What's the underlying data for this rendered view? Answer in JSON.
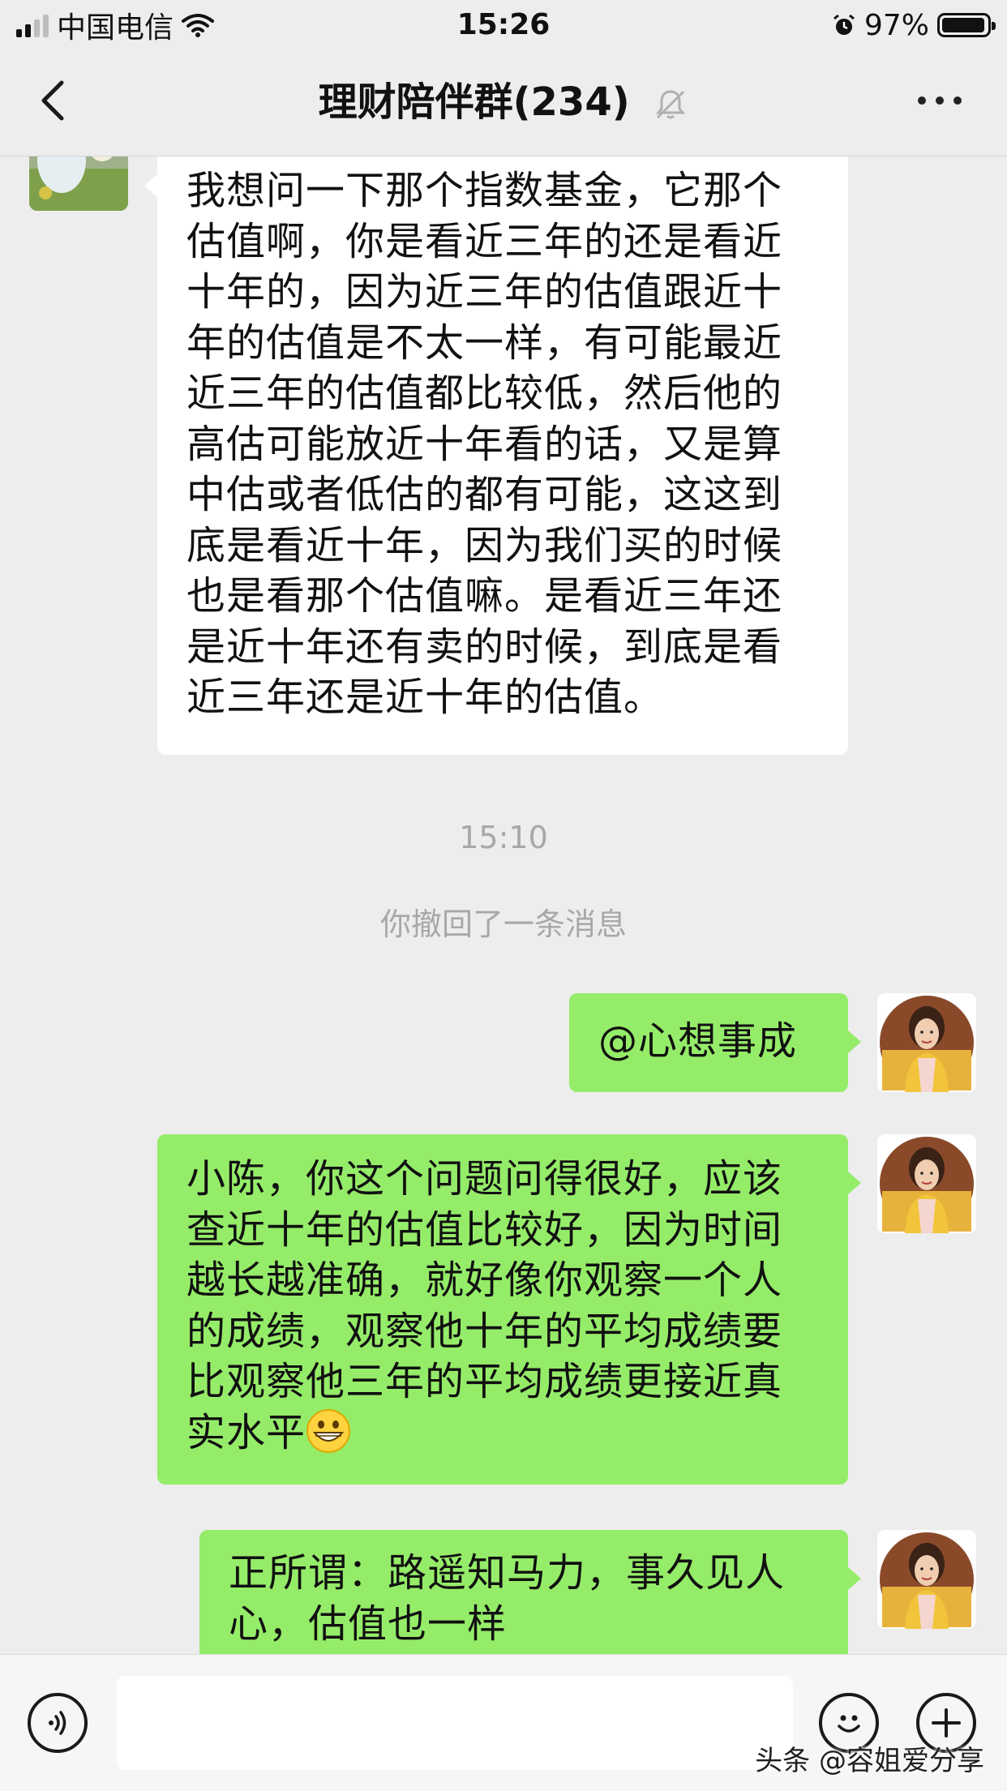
{
  "status_bar": {
    "carrier": "中国电信",
    "time": "15:26",
    "battery_percent_text": "97%",
    "battery_level": 0.97,
    "signal_bars_filled": 2,
    "signal_bars_total": 4
  },
  "navbar": {
    "title": "理财陪伴群(234)",
    "back_icon": "chevron-left-icon",
    "mute_icon": "bell-off-icon",
    "more_icon": "more-dots-icon"
  },
  "messages": {
    "incoming_1": "我想问一下那个指数基金，它那个估值啊，你是看近三年的还是看近十年的，因为近三年的估值跟近十年的估值是不太一样，有可能最近近三年的估值都比较低，然后他的高估可能放近十年看的话，又是算中估或者低估的都有可能，这这到底是看近十年，因为我们买的时候也是看那个估值嘛。是看近三年还是近十年还有卖的时候，到底是看近三年还是近十年的估值。",
    "timestamp": "15:10",
    "system_notice": "你撤回了一条消息",
    "outgoing_1": "@心想事成",
    "outgoing_2": "小陈，你这个问题问得很好，应该查近十年的估值比较好，因为时间越长越准确，就好像你观察一个人的成绩，观察他十年的平均成绩要比观察他三年的平均成绩更接近真实水平",
    "outgoing_2_emoji": "grinning-face-icon",
    "outgoing_3": "正所谓：路遥知马力，事久见人心，估值也一样"
  },
  "input_bar": {
    "voice_icon": "voice-icon",
    "emoji_icon": "emoji-icon",
    "plus_icon": "plus-icon",
    "input_value": ""
  },
  "watermark": "头条 @容姐爱分享",
  "colors": {
    "background": "#ededed",
    "incoming_bubble": "#ffffff",
    "outgoing_bubble": "#95ec69",
    "meta_text": "#a8a8a8"
  }
}
